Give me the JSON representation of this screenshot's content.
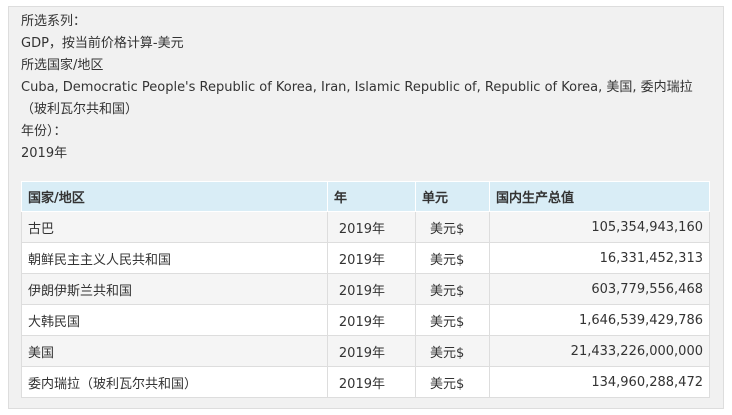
{
  "filters": {
    "series_label": "所选系列：",
    "series_value": "GDP，按当前价格计算-美元",
    "country_label": "所选国家/地区",
    "country_value_line1": "Cuba, Democratic People's Republic of Korea, Iran, Islamic Republic of, Republic of Korea, 美国, 委内瑞拉",
    "country_value_line2": "（玻利瓦尔共和国）",
    "year_label": "年份）：",
    "year_value": "2019年"
  },
  "table": {
    "headers": [
      "国家/地区",
      "年",
      "单元",
      "国内生产总值"
    ],
    "rows": [
      {
        "country": "古巴",
        "year": "2019年",
        "unit": "美元$",
        "gdp": "105,354,943,160"
      },
      {
        "country": "朝鲜民主主义人民共和国",
        "year": "2019年",
        "unit": "美元$",
        "gdp": "16,331,452,313"
      },
      {
        "country": "伊朗伊斯兰共和国",
        "year": "2019年",
        "unit": "美元$",
        "gdp": "603,779,556,468"
      },
      {
        "country": "大韩民国",
        "year": "2019年",
        "unit": "美元$",
        "gdp": "1,646,539,429,786"
      },
      {
        "country": "美国",
        "year": "2019年",
        "unit": "美元$",
        "gdp": "21,433,226,000,000"
      },
      {
        "country": "委内瑞拉（玻利瓦尔共和国）",
        "year": "2019年",
        "unit": "美元$",
        "gdp": "134,960,288,472"
      }
    ]
  }
}
